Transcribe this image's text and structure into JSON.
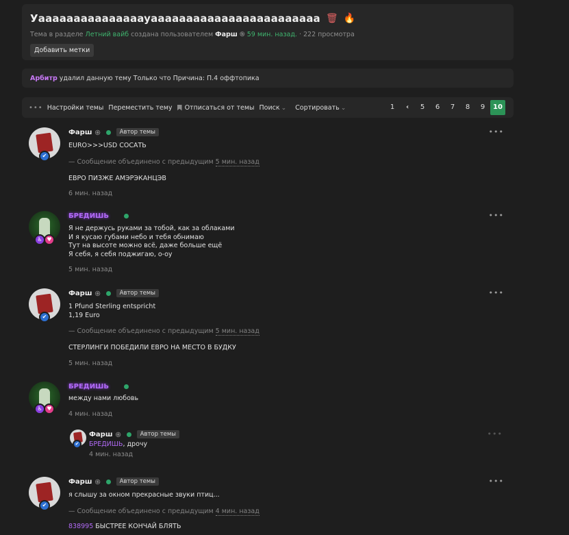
{
  "header": {
    "title": "Уaaaaaaaaaaaaaaayaaaaaaaaaaaaaaaaaaaaaaaa",
    "meta_prefix": "Тема в разделе",
    "section": "Летний вайб",
    "meta_created": "создана пользователем",
    "author": "Фарш",
    "time": "59 мин. назад.",
    "views": "· 222 просмотра",
    "add_tags": "Добавить метки"
  },
  "notice": {
    "user": "Арбитр",
    "text": "удалил данную тему Только что Причина: П.4 оффтопика"
  },
  "toolbar": {
    "settings": "Настройки темы",
    "move": "Переместить тему",
    "unsubscribe": "Отписаться от темы",
    "search": "Поиск",
    "sort": "Сортировать",
    "pages": [
      "1",
      "‹",
      "5",
      "6",
      "7",
      "8",
      "9",
      "10"
    ],
    "current_page": "10"
  },
  "posts": [
    {
      "user": "Фарш",
      "author_badge": "Автор темы",
      "text1": "EURO>>>USD СОСАТЬ",
      "merged_prefix": "— Сообщение объединено с предыдущим",
      "merged_time": "5 мин. назад",
      "text2": "ЕВРО ПИЗЖЕ АМЭРЭКАНЦЭВ",
      "time": "6 мин. назад"
    },
    {
      "user": "БРЕДИШЬ",
      "lines": [
        "Я не держусь руками за тобой, как за облаками",
        "И я кусаю губами небо и тебя обнимаю",
        "Тут на высоте можно всё, даже больше ещё",
        "Я себя, я себя поджигаю, о-оу"
      ],
      "time": "5 мин. назад"
    },
    {
      "user": "Фарш",
      "author_badge": "Автор темы",
      "line1": "1 Pfund Sterling entspricht",
      "line2": "1,19 Euro",
      "merged_prefix": "— Сообщение объединено с предыдущим",
      "merged_time": "5 мин. назад",
      "text2": "СТЕРЛИНГИ ПОБЕДИЛИ ЕВРО НА МЕСТО В БУДКУ",
      "time": "5 мин. назад"
    },
    {
      "user": "БРЕДИШЬ",
      "text": "между нами любовь",
      "time": "4 мин. назад"
    },
    {
      "user": "Фарш",
      "author_badge": "Автор темы",
      "mention": "БРЕДИШЬ",
      "text": ", дрочу",
      "time": "4 мин. назад"
    },
    {
      "user": "Фарш",
      "author_badge": "Автор темы",
      "text1": "я слышу за окном прекрасные звуки птиц...",
      "merged_prefix": "— Сообщение объединено с предыдущим",
      "merged_time": "4 мин. назад",
      "number": "838995",
      "text2": " БЫСТРЕЕ КОНЧАЙ БЛЯТЬ"
    }
  ],
  "icons": {
    "more": "•••",
    "spiral": "֍",
    "trash": "🗑",
    "fire": "🔥",
    "check": "✔",
    "wheelchair": "♿",
    "heart": "♥"
  },
  "colors": {
    "accent_green": "#2c9357",
    "link_green": "#3fb46e",
    "purple_name": "#b16af5",
    "arbiter": "#c879f6"
  }
}
